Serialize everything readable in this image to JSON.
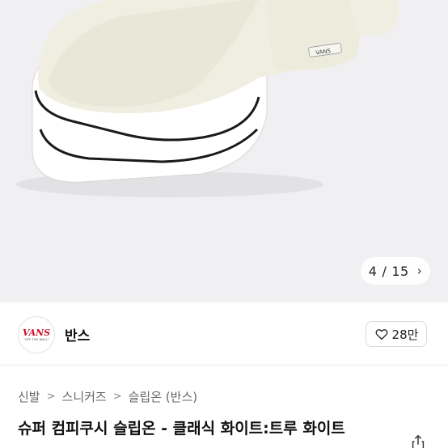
{
  "gallery": {
    "current": "4",
    "divider": "/",
    "total": "15",
    "next_icon": "chevron-right-icon",
    "brand_tag_on_shoe": "VANS"
  },
  "seller": {
    "avatar_logo": "VANS",
    "avatar_tagline": "\"OFF THE WALL\"",
    "name": "반스",
    "likes": "28만",
    "like_icon": "heart-outline-icon"
  },
  "breadcrumb": [
    "신발",
    "스니커즈",
    "슬립온 (반스)"
  ],
  "product": {
    "title": "슈퍼 컴피쿠시 슬립온 - 클래식 화이트:트루 화이트",
    "share_icon": "share-icon"
  }
}
